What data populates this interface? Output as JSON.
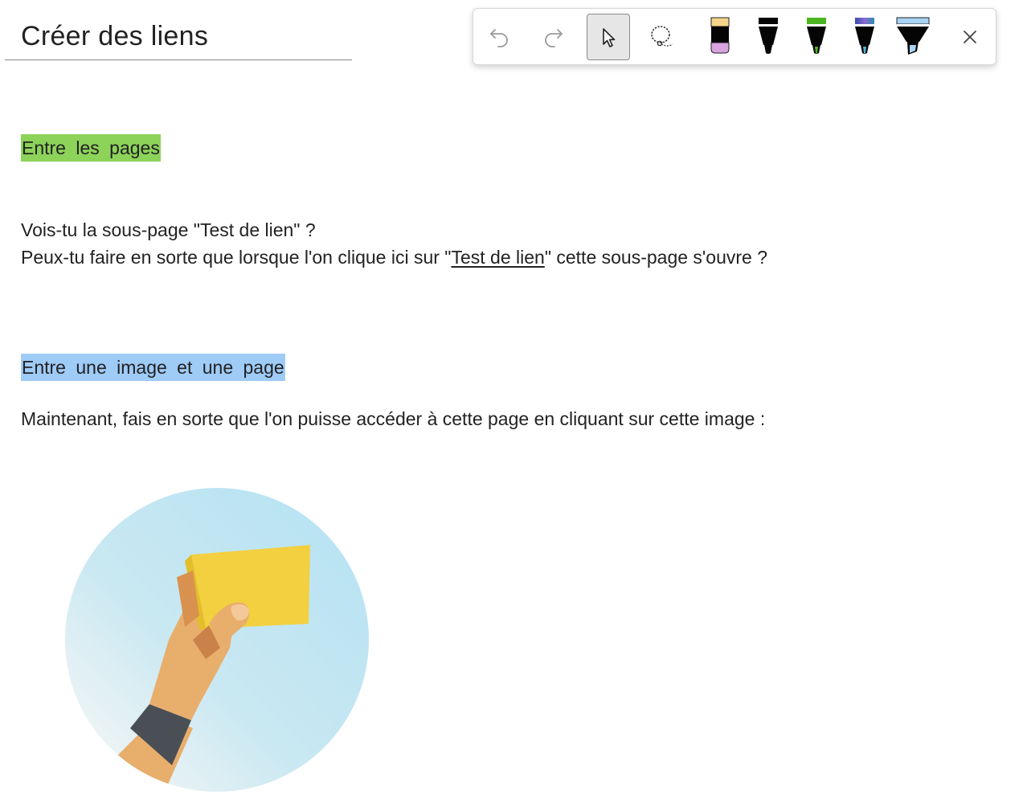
{
  "page": {
    "title": "Créer des liens"
  },
  "toolbar": {
    "buttons": [
      {
        "name": "undo",
        "icon": "undo-icon",
        "enabled": false
      },
      {
        "name": "redo",
        "icon": "redo-icon",
        "enabled": false
      },
      {
        "name": "select",
        "icon": "cursor-icon",
        "selected": true
      },
      {
        "name": "lasso",
        "icon": "lasso-icon"
      },
      {
        "name": "pen-pink",
        "icon": "highlighter-pen-icon",
        "color": "#d9a3e0"
      },
      {
        "name": "pen-black",
        "icon": "pen-icon",
        "color": "#000000"
      },
      {
        "name": "pen-green",
        "icon": "pen-icon",
        "color": "#4bb51f"
      },
      {
        "name": "pen-galaxy",
        "icon": "pen-icon",
        "color": "#2c8fb0"
      },
      {
        "name": "highlighter-blue",
        "icon": "highlighter-icon",
        "color": "#a8d4f5"
      },
      {
        "name": "close",
        "icon": "close-icon"
      }
    ]
  },
  "content": {
    "section1_heading": "Entre les pages",
    "line1": "Vois-tu la sous-page \"Test de lien\" ?",
    "line2_before": "Peux-tu faire en sorte que lorsque l'on clique ici sur \"",
    "line2_link": "Test de lien",
    "line2_after": "\" cette sous-page s'ouvre ?",
    "section2_heading": "Entre une image et une page",
    "line3": "Maintenant, fais en sorte que l'on puisse accéder à cette page en cliquant sur cette image :"
  },
  "colors": {
    "highlight_green": "#8dd35a",
    "highlight_blue": "#9fcbf7"
  },
  "image": {
    "icon": "hand-holding-card-icon"
  }
}
